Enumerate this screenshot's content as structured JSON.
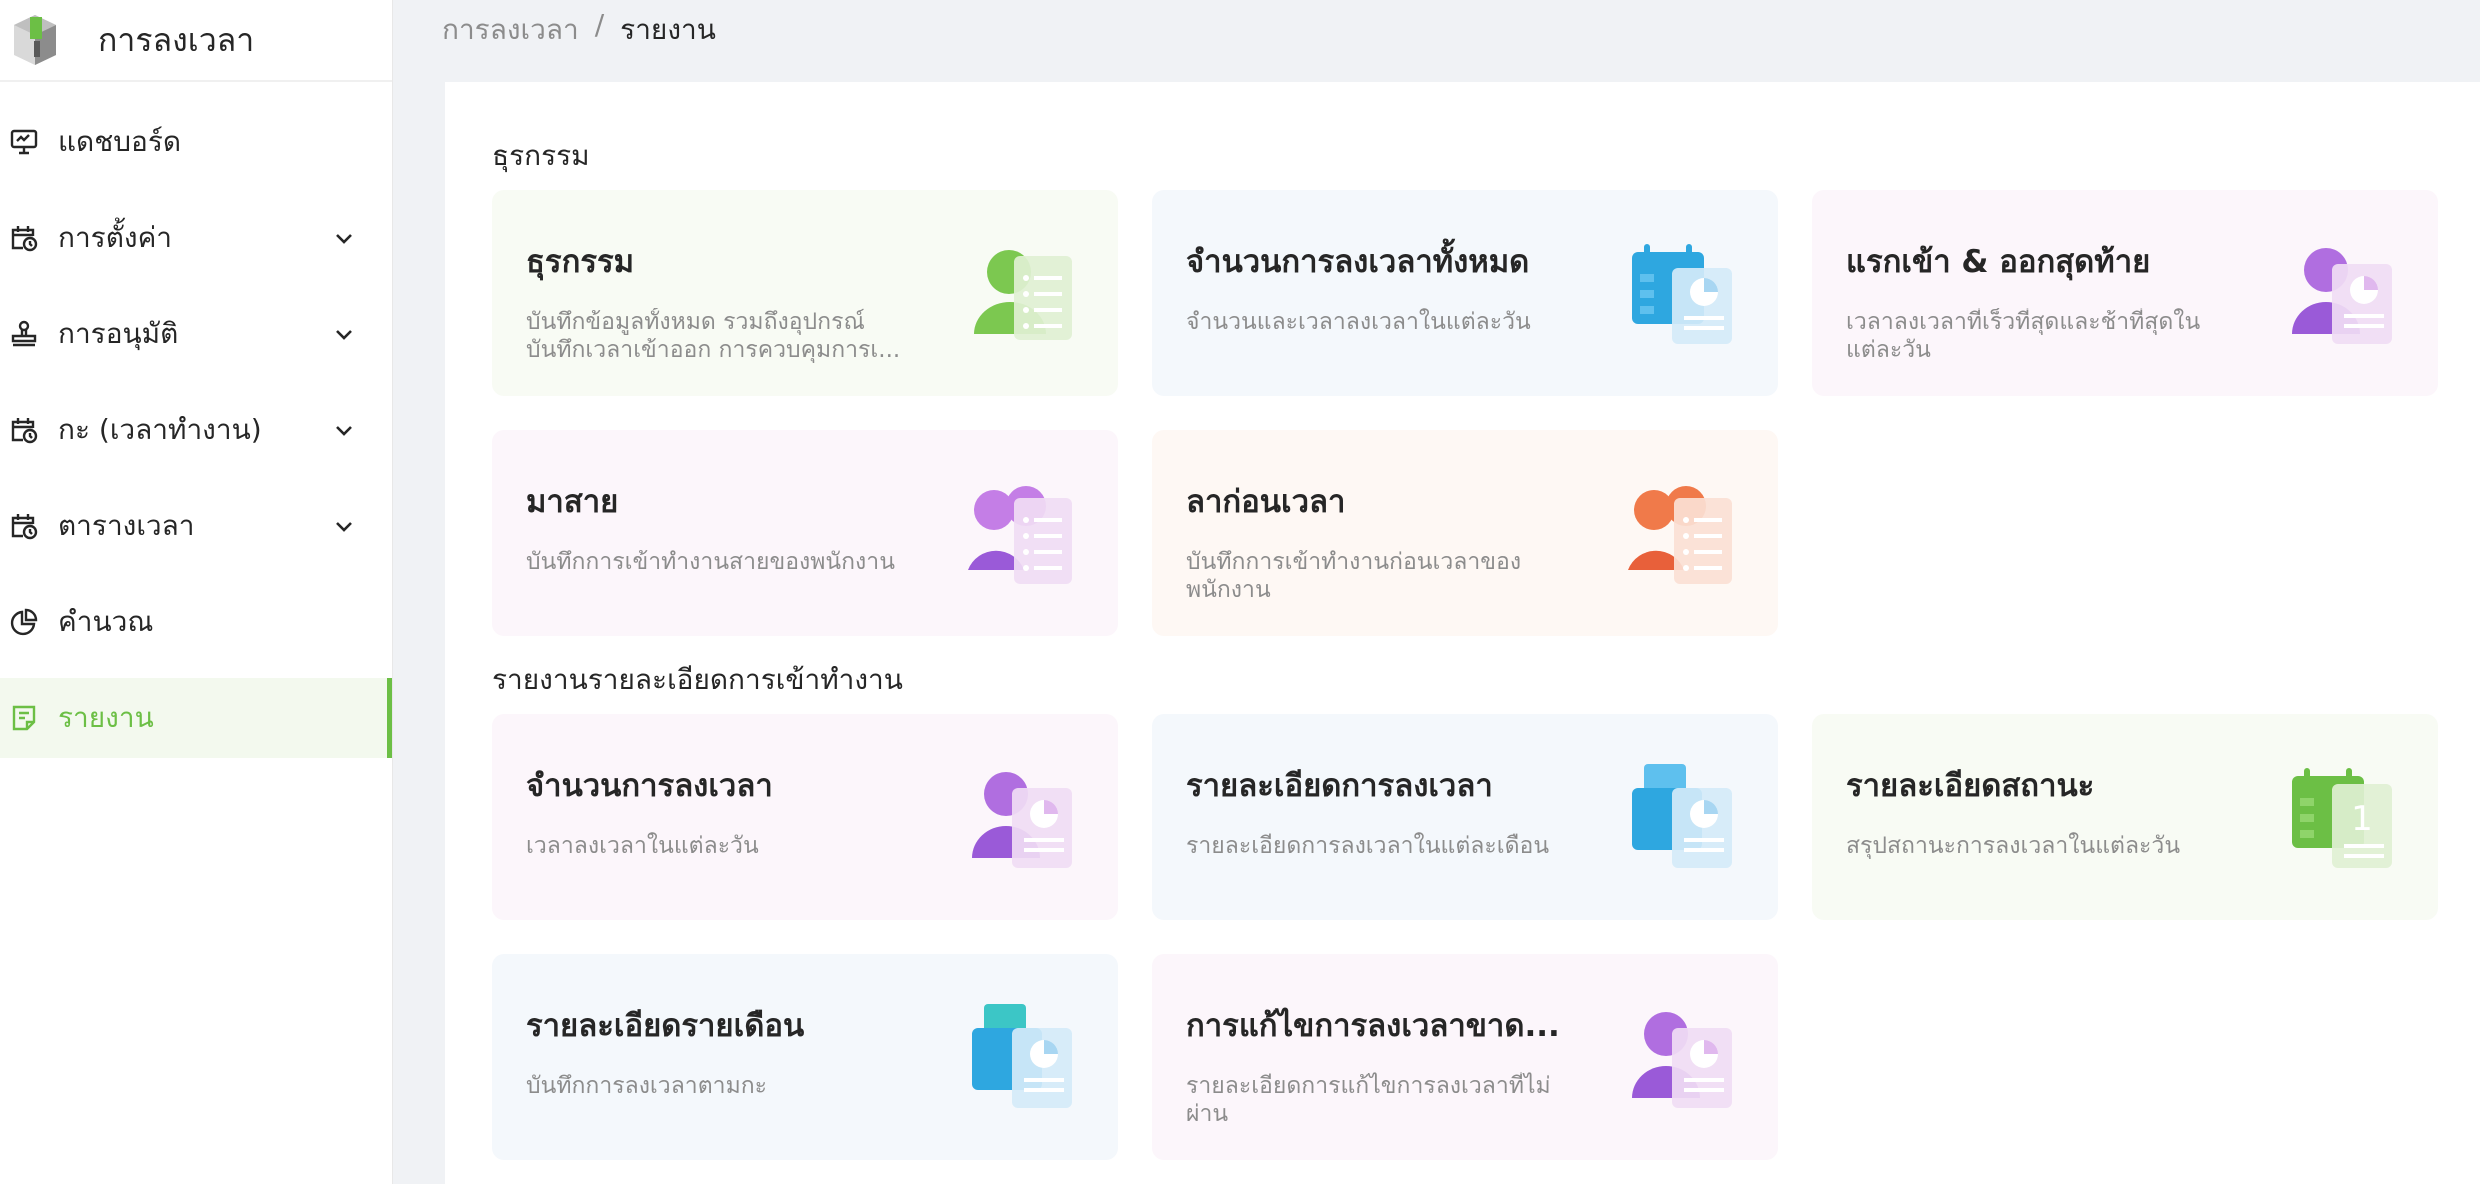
{
  "app": {
    "title": "การลงเวลา"
  },
  "sidebar": {
    "items": [
      {
        "label": "แดชบอร์ด",
        "icon": "monitor-icon"
      },
      {
        "label": "การตั้งค่า",
        "icon": "calendar-clock-icon"
      },
      {
        "label": "การอนุมัติ",
        "icon": "stamp-icon"
      },
      {
        "label": "กะ (เวลาทำงาน)",
        "icon": "calendar-clock-icon"
      },
      {
        "label": "ตารางเวลา",
        "icon": "calendar-clock-icon"
      },
      {
        "label": "คำนวณ",
        "icon": "pie-chart-icon"
      },
      {
        "label": "รายงาน",
        "icon": "report-icon",
        "active": true
      }
    ]
  },
  "breadcrumb": {
    "parent": "การลงเวลา",
    "separator": "/",
    "current": "รายงาน"
  },
  "sections": [
    {
      "title": "ธุรกรรม",
      "cards": [
        {
          "title": "ธุรกรรม",
          "desc": "บันทึกข้อมูลทั้งหมด รวมถึงอุปกรณ์ บันทึกเวลาเข้าออก การควบคุมการเ...",
          "icon": "user-list-icon"
        },
        {
          "title": "จำนวนการลงเวลาทั้งหมด",
          "desc": "จำนวนและเวลาลงเวลาในแต่ละวัน",
          "icon": "calendar-chart-icon"
        },
        {
          "title": "แรกเข้า & ออกสุดท้าย",
          "desc": "เวลาลงเวลาที่เร็วที่สุดและช้าที่สุดในแต่ละวัน",
          "icon": "user-chart-icon"
        },
        {
          "title": "มาสาย",
          "desc": "บันทึกการเข้าทำงานสายของพนักงาน",
          "icon": "users-list-icon"
        },
        {
          "title": "ลาก่อนเวลา",
          "desc": "บันทึกการเข้าทำงานก่อนเวลาของพนักงาน",
          "icon": "users-list-icon"
        }
      ]
    },
    {
      "title": "รายงานรายละเอียดการเข้าทำงาน",
      "cards": [
        {
          "title": "จำนวนการลงเวลา",
          "desc": "เวลาลงเวลาในแต่ละวัน",
          "icon": "user-chart-icon"
        },
        {
          "title": "รายละเอียดการลงเวลา",
          "desc": "รายละเอียดการลงเวลาในแต่ละเดือน",
          "icon": "folder-chart-icon"
        },
        {
          "title": "รายละเอียดสถานะ",
          "desc": "สรุปสถานะการลงเวลาในแต่ละวัน",
          "icon": "calendar-one-icon"
        },
        {
          "title": "รายละเอียดรายเดือน",
          "desc": "บันทึกการลงเวลาตามกะ",
          "icon": "folder-chart-icon"
        },
        {
          "title": "การแก้ไขการลงเวลาขาด...",
          "desc": "รายละเอียดการแก้ไขการลงเวลาที่ไม่ผ่าน",
          "icon": "user-chart-icon"
        }
      ]
    }
  ],
  "colors": {
    "accent": "#6cbf45",
    "green": "#7cc850",
    "blue": "#2ea7e0",
    "purple": "#b06ee0",
    "orange": "#f07a4a"
  }
}
